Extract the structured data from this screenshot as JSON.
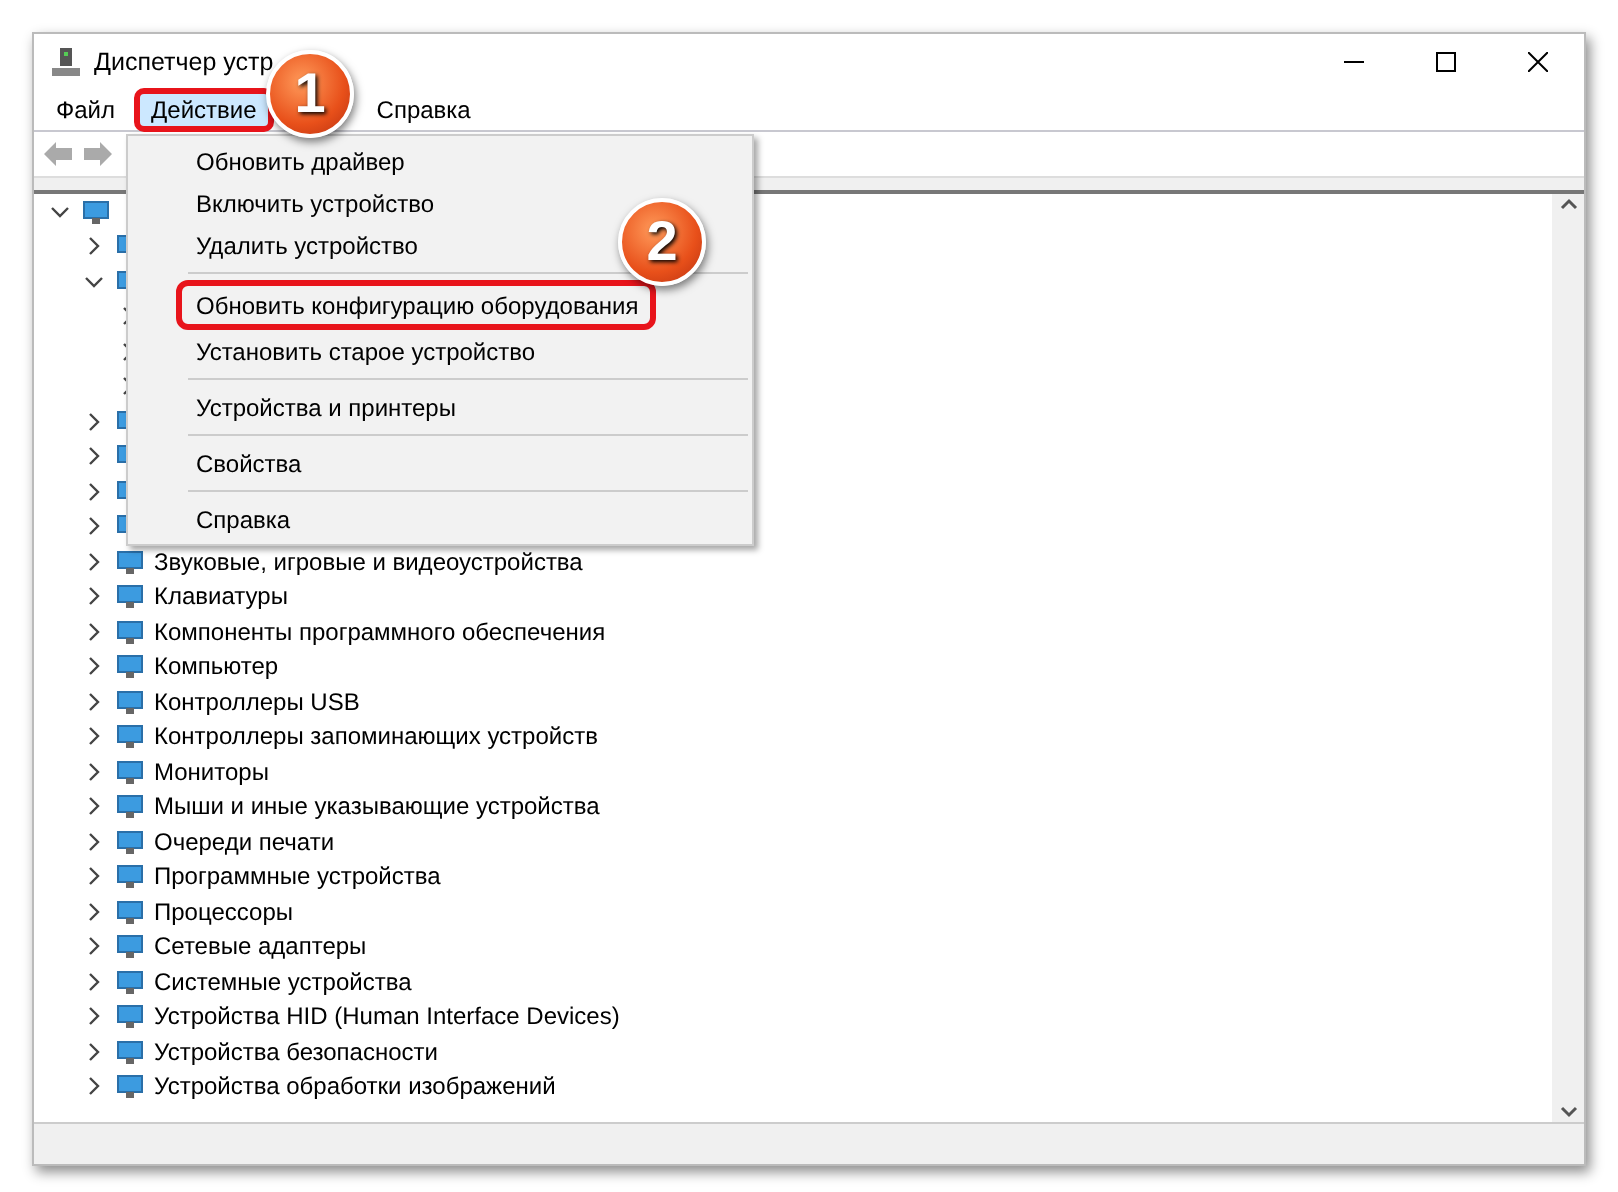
{
  "window": {
    "title": "Диспетчер устр"
  },
  "menubar": [
    {
      "label": "Файл",
      "selected": false,
      "highlighted": false
    },
    {
      "label": "Действие",
      "selected": true,
      "highlighted": true
    },
    {
      "label": "Справка",
      "selected": false,
      "highlighted": false
    }
  ],
  "context_menu": [
    {
      "label": "Обновить драйвер",
      "separator_before": false,
      "highlighted": false
    },
    {
      "label": "Включить устройство",
      "separator_before": false,
      "highlighted": false
    },
    {
      "label": "Удалить устройство",
      "separator_before": false,
      "highlighted": false
    },
    {
      "label": "Обновить конфигурацию оборудования",
      "separator_before": true,
      "highlighted": true
    },
    {
      "label": "Установить старое устройство",
      "separator_before": false,
      "highlighted": false
    },
    {
      "label": "Устройства и принтеры",
      "separator_before": true,
      "highlighted": false
    },
    {
      "label": "Свойства",
      "separator_before": true,
      "highlighted": false
    },
    {
      "label": "Справка",
      "separator_before": true,
      "highlighted": false
    }
  ],
  "tree": [
    {
      "expanded": true,
      "children": [
        {
          "expanded": false
        },
        {
          "expanded": true,
          "children": [
            {
              "expanded": false
            },
            {
              "expanded": false
            },
            {
              "expanded": false
            }
          ]
        },
        {
          "expanded": false
        },
        {
          "expanded": false
        },
        {
          "expanded": false
        },
        {
          "expanded": false
        },
        {
          "label": "Звуковые, игровые и видеоустройства",
          "expanded": false
        },
        {
          "label": "Клавиатуры",
          "expanded": false
        },
        {
          "label": "Компоненты программного обеспечения",
          "expanded": false
        },
        {
          "label": "Компьютер",
          "expanded": false
        },
        {
          "label": "Контроллеры USB",
          "expanded": false
        },
        {
          "label": "Контроллеры запоминающих устройств",
          "expanded": false
        },
        {
          "label": "Мониторы",
          "expanded": false
        },
        {
          "label": "Мыши и иные указывающие устройства",
          "expanded": false
        },
        {
          "label": "Очереди печати",
          "expanded": false
        },
        {
          "label": "Программные устройства",
          "expanded": false
        },
        {
          "label": "Процессоры",
          "expanded": false
        },
        {
          "label": "Сетевые адаптеры",
          "expanded": false
        },
        {
          "label": "Системные устройства",
          "expanded": false
        },
        {
          "label": "Устройства HID (Human Interface Devices)",
          "expanded": false
        },
        {
          "label": "Устройства безопасности",
          "expanded": false
        },
        {
          "label": "Устройства обработки изображений",
          "expanded": false
        }
      ]
    }
  ],
  "badges": [
    {
      "label": "1"
    },
    {
      "label": "2"
    }
  ]
}
